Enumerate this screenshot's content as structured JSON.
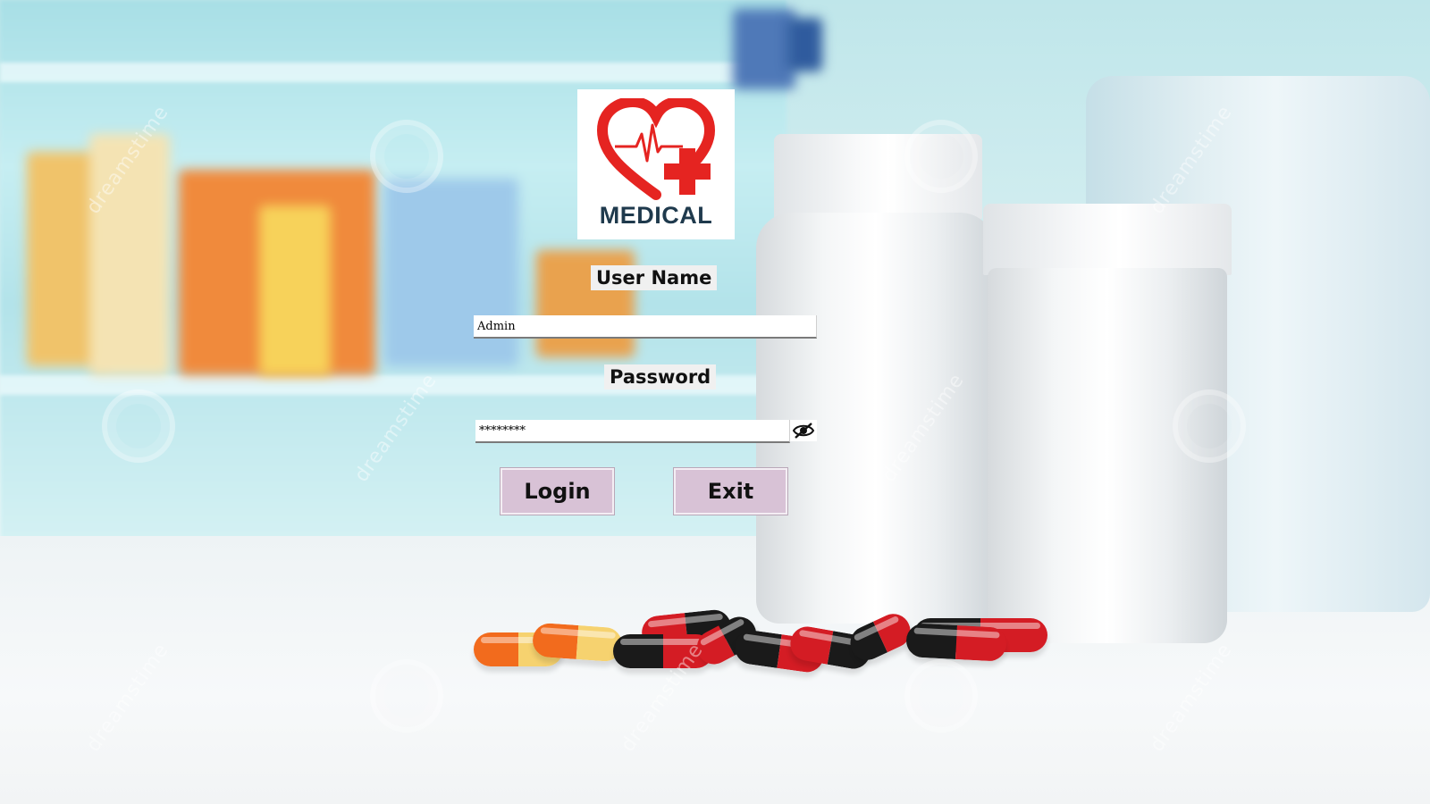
{
  "logo": {
    "text": "MEDICAL",
    "colors": {
      "heart": "#e52421",
      "cross": "#e52421",
      "text": "#1f3a4d"
    }
  },
  "form": {
    "username_label": "User Name",
    "username_value": "Admin",
    "password_label": "Password",
    "password_value": "********",
    "toggle_icon": "eye-slash-icon"
  },
  "buttons": {
    "login_label": "Login",
    "exit_label": "Exit",
    "color": "#d8c2d6"
  },
  "watermark": {
    "text": "dreamstime"
  }
}
